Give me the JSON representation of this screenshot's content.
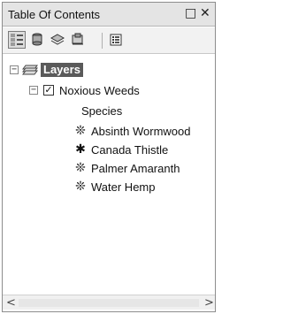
{
  "window": {
    "title": "Table Of Contents",
    "pin_icon": "□",
    "close_icon": "✕"
  },
  "toolbar": {
    "buttons": [
      {
        "name": "list-by-drawing-order-button",
        "icon": "drawing-order-icon"
      },
      {
        "name": "list-by-source-button",
        "icon": "source-icon"
      },
      {
        "name": "list-by-visibility-button",
        "icon": "visibility-icon"
      },
      {
        "name": "list-by-selection-button",
        "icon": "selection-icon"
      },
      {
        "name": "options-button",
        "icon": "options-icon"
      }
    ]
  },
  "tree": {
    "root": {
      "label": "Layers",
      "expander": "−",
      "icon": "layers-icon"
    },
    "layer": {
      "label": "Noxious Weeds",
      "expander": "−",
      "checked": "✓"
    },
    "field": "Species",
    "legend": [
      {
        "label": "Absinth Wormwood",
        "symbol": "❊"
      },
      {
        "label": "Canada Thistle",
        "symbol": "✱"
      },
      {
        "label": "Palmer Amaranth",
        "symbol": "❊"
      },
      {
        "label": "Water Hemp",
        "symbol": "❊"
      }
    ]
  },
  "scrollbar": {
    "left_arrow": "<",
    "right_arrow": ">"
  }
}
